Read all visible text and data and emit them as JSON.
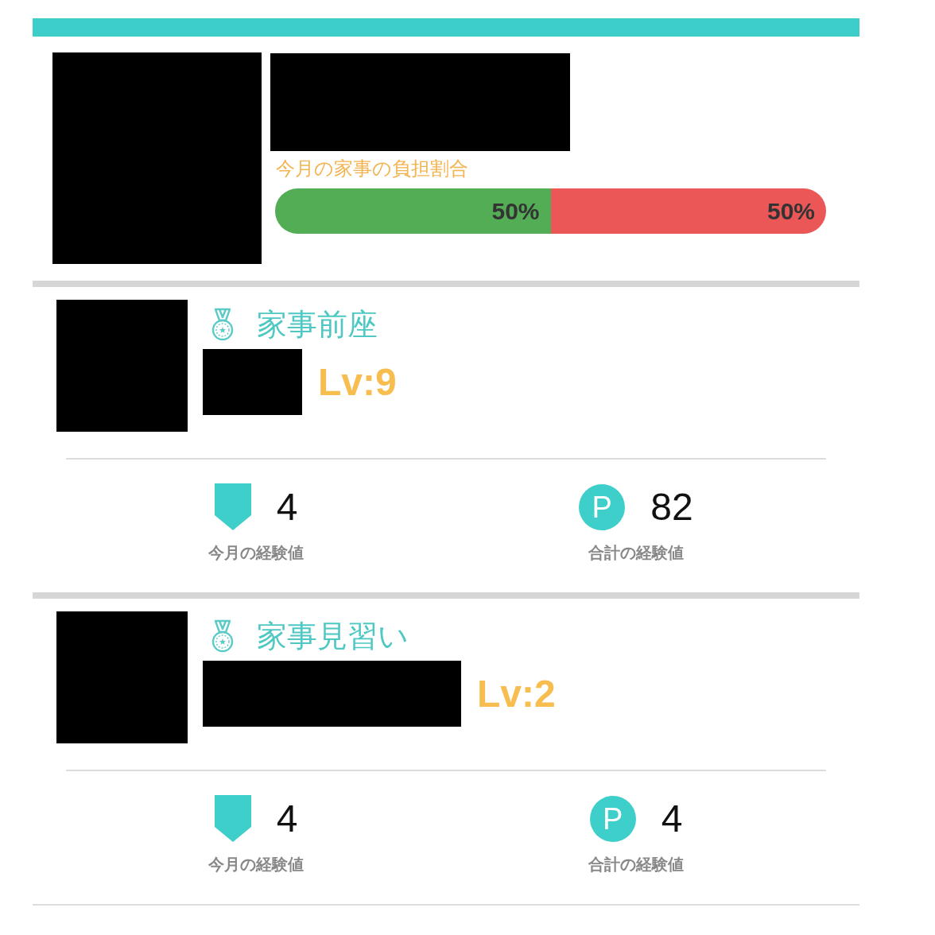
{
  "burden": {
    "label": "今月の家事の負担割合",
    "shares": [
      {
        "level": 0.5,
        "reading": "50%",
        "color": "#52ad55"
      },
      {
        "level": 0.5,
        "reading": "50%",
        "color": "#eb5757"
      }
    ]
  },
  "members": [
    {
      "title": "家事前座",
      "level_label": "Lv:9",
      "stats": [
        {
          "kind": "month",
          "value": "4",
          "label": "今月の経験値"
        },
        {
          "kind": "total",
          "icon_text": "P",
          "value": "82",
          "label": "合計の経験値"
        }
      ]
    },
    {
      "title": "家事見習い",
      "level_label": "Lv:2",
      "stats": [
        {
          "kind": "month",
          "value": "4",
          "label": "今月の経験値"
        },
        {
          "kind": "total",
          "icon_text": "P",
          "value": "4",
          "label": "合計の経験値"
        }
      ]
    }
  ]
}
